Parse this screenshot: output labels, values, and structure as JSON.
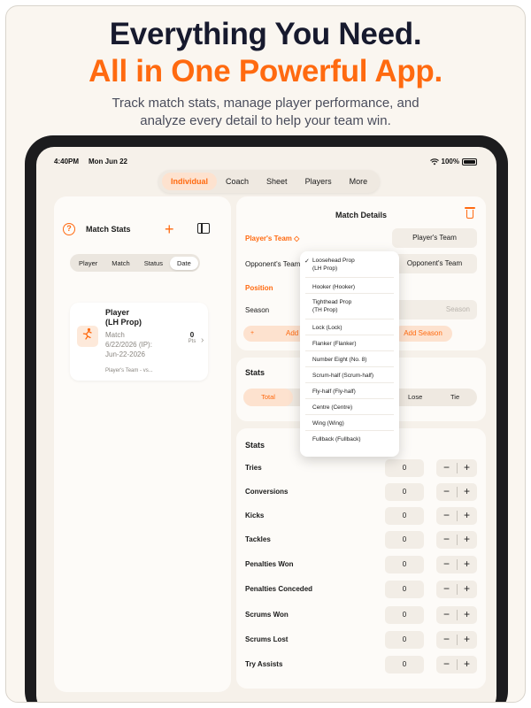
{
  "promo": {
    "headline_line1": "Everything You Need.",
    "headline_line2": "All in One Powerful App.",
    "subtitle_line1": "Track match stats, manage player performance, and",
    "subtitle_line2": "analyze every detail to help your team win.",
    "headline_color": "#171a2e",
    "accent_color": "#ff6a10"
  },
  "status_bar": {
    "time": "4:40PM",
    "date": "Mon Jun 22",
    "battery": "100%"
  },
  "top_tabs": [
    {
      "label": "Individual",
      "active": true
    },
    {
      "label": "Coach"
    },
    {
      "label": "Sheet"
    },
    {
      "label": "Players"
    },
    {
      "label": "More"
    }
  ],
  "left_panel": {
    "title": "Match Stats",
    "sort_options": [
      {
        "label": "Player"
      },
      {
        "label": "Match"
      },
      {
        "label": "Status"
      },
      {
        "label": "Date",
        "active": true
      }
    ],
    "card": {
      "name_line1": "Player",
      "name_line2": "(LH Prop)",
      "line1": "Match",
      "line2": "6/22/2026 (IP):",
      "line3": "Jun-22-2026",
      "team": "Player's Team - vs...",
      "points_value": "0",
      "points_label": "Pts"
    }
  },
  "match_details": {
    "title": "Match Details",
    "players_team_label": "Player's Team ◇",
    "players_team_value": "Player's Team",
    "opponents_team_label": "Opponent's Team",
    "opponents_team_value": "Opponent's Team",
    "position_label": "Position",
    "season_label": "Season",
    "season_placeholder": "Season",
    "add_left_label": "Add",
    "add_left_prefix": "+",
    "add_season_label": "Add Season"
  },
  "stats_summary": {
    "title": "Stats",
    "options": [
      "Total",
      "Lose",
      "Tie"
    ]
  },
  "stats": {
    "title": "Stats",
    "rows": [
      {
        "label": "Tries",
        "value": "0"
      },
      {
        "label": "Conversions",
        "value": "0"
      },
      {
        "label": "Kicks",
        "value": "0"
      },
      {
        "label": "Tackles",
        "value": "0"
      },
      {
        "label": "Penalties Won",
        "value": "0"
      },
      {
        "label": "Penalties Conceded",
        "value": "0"
      },
      {
        "label": "Scrums Won",
        "value": "0"
      },
      {
        "label": "Scrums Lost",
        "value": "0"
      },
      {
        "label": "Try Assists",
        "value": "0"
      }
    ],
    "minus": "−",
    "plus": "+"
  },
  "position_dropdown": {
    "selected_check": "✓",
    "items": [
      {
        "line1": "Loosehead Prop",
        "line2": "(LH Prop)",
        "selected": true
      },
      {
        "line1": "Hooker (Hooker)"
      },
      {
        "line1": "Tighthead Prop",
        "line2": "(TH Prop)"
      },
      {
        "line1": "Lock (Lock)"
      },
      {
        "line1": "Flanker (Flanker)"
      },
      {
        "line1": "Number Eight (No. 8)"
      },
      {
        "line1": "Scrum-half (Scrum-half)"
      },
      {
        "line1": "Fly-half (Fly-half)"
      },
      {
        "line1": "Centre (Centre)"
      },
      {
        "line1": "Wing (Wing)"
      },
      {
        "line1": "Fullback (Fullback)"
      }
    ]
  }
}
